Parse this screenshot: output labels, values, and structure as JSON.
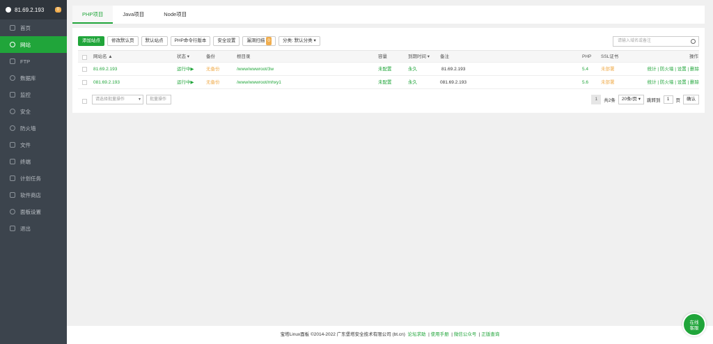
{
  "header": {
    "host": "81.69.2.193",
    "badge": "0"
  },
  "sidebar": {
    "items": [
      {
        "label": "首页"
      },
      {
        "label": "网站"
      },
      {
        "label": "FTP"
      },
      {
        "label": "数据库"
      },
      {
        "label": "监控"
      },
      {
        "label": "安全"
      },
      {
        "label": "防火墙"
      },
      {
        "label": "文件"
      },
      {
        "label": "终端"
      },
      {
        "label": "计划任务"
      },
      {
        "label": "软件商店"
      },
      {
        "label": "面板设置"
      },
      {
        "label": "退出"
      }
    ]
  },
  "tabs": [
    "PHP项目",
    "Java项目",
    "Node项目"
  ],
  "toolbar": {
    "add_site": "添加站点",
    "edit_default_page": "修改默认页",
    "default_site": "默认站点",
    "php_cli": "PHP命令行版本",
    "security": "安全设置",
    "scan": "漏洞扫描",
    "scan_count": "0",
    "category": "分类: 默认分类",
    "search_placeholder": "请输入域名或备注"
  },
  "table": {
    "headers": {
      "name": "网站名 ▲",
      "status": "状态 ▾",
      "backup": "备份",
      "root": "根目录",
      "capacity": "容量",
      "expire": "到期时间 ▾",
      "remark": "备注",
      "php": "PHP",
      "ssl": "SSL证书",
      "action": "操作"
    },
    "rows": [
      {
        "name": "81.69.2.193",
        "status": "运行中▶",
        "backup": "无备份",
        "root": "/www/wwwroot/3w",
        "capacity": "未配置",
        "expire": "永久",
        "remark": "81.69.2.193",
        "php": "5.4",
        "ssl": "未部署",
        "actions": "统计 | 防火墙 | 设置 | 删除"
      },
      {
        "name": "081.69.2.193",
        "status": "运行中▶",
        "backup": "无备份",
        "root": "/www/wwwroot/mhxy1",
        "capacity": "未配置",
        "expire": "永久",
        "remark": "081.69.2.193",
        "php": "5.6",
        "ssl": "未部署",
        "actions": "统计 | 防火墙 | 设置 | 删除"
      }
    ]
  },
  "bottom": {
    "batch_select": "请选择批量操作",
    "batch_btn": "批量操作",
    "page": "1",
    "total": "共2条",
    "per_page": "20条/页",
    "jump_to": "跳转到",
    "jump_value": "1",
    "page_unit": "页",
    "confirm": "确认"
  },
  "footer": {
    "copyright": "宝塔Linux面板 ©2014-2022 广东堡塔安全技术有限公司 (bt.cn)",
    "links": [
      "论坛求助",
      "使用手册",
      "微信公众号",
      "正版查询"
    ]
  },
  "chat": {
    "line1": "在线",
    "line2": "客服"
  },
  "colors": {
    "accent": "#20a53a",
    "warning": "#f0ad4e",
    "sidebar": "#3c444d"
  }
}
